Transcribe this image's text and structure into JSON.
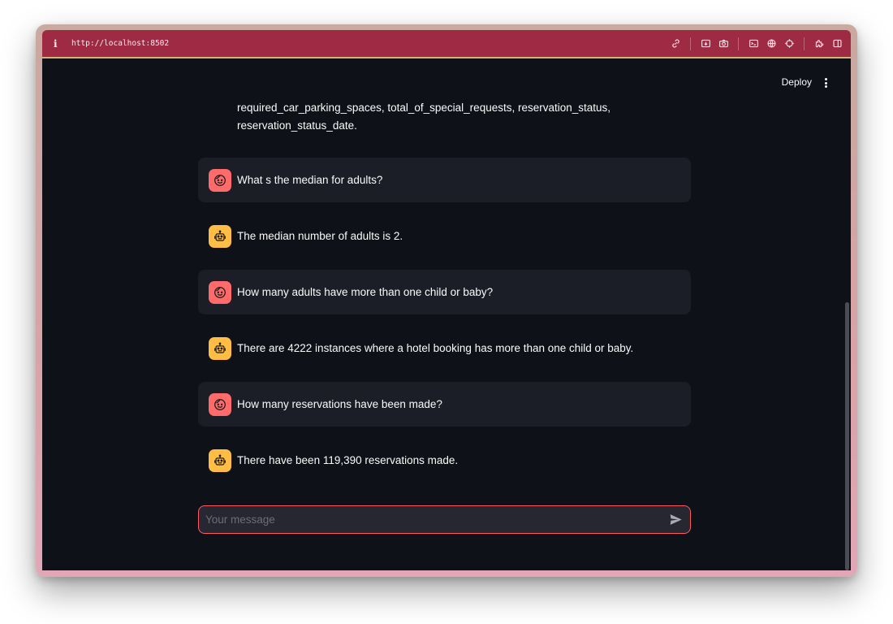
{
  "browser": {
    "info_glyph": "i",
    "url": "http://localhost:8502"
  },
  "header": {
    "deploy_label": "Deploy"
  },
  "chat": {
    "context_text": "required_car_parking_spaces, total_of_special_requests, reservation_status, reservation_status_date.",
    "messages": [
      {
        "role": "user",
        "text": "What s the median for adults?"
      },
      {
        "role": "assistant",
        "text": "The median number of adults is 2."
      },
      {
        "role": "user",
        "text": "How many adults have more than one child or baby?"
      },
      {
        "role": "assistant",
        "text": "There are 4222 instances where a hotel booking has more than one child or baby."
      },
      {
        "role": "user",
        "text": "How many reservations have been made?"
      },
      {
        "role": "assistant",
        "text": "There have been 119,390 reservations made."
      }
    ],
    "input": {
      "value": "",
      "placeholder": "Your message"
    }
  },
  "colors": {
    "browser_bar": "#9e2a44",
    "app_background": "#0e1117",
    "user_message_bg": "#1b1e26",
    "user_avatar": "#ff6b6b",
    "assistant_avatar": "#ffbd45",
    "input_border": "#ff5a5f"
  },
  "icons": {
    "user_avatar": "smiley-face-icon",
    "assistant_avatar": "robot-icon",
    "send": "send-icon"
  }
}
